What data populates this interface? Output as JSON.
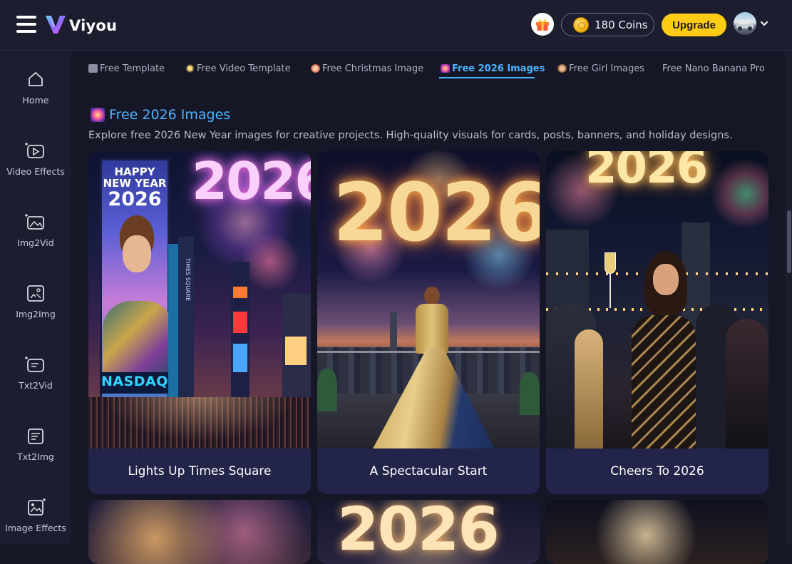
{
  "brand": {
    "name": "Viyou"
  },
  "header": {
    "coins_label": "180 Coins",
    "upgrade_label": "Upgrade",
    "accent_color": "#ffcb14"
  },
  "sidebar": {
    "items": [
      {
        "label": "Home",
        "icon": "home-icon"
      },
      {
        "label": "Video Effects",
        "icon": "video-effects-icon"
      },
      {
        "label": "Img2Vid",
        "icon": "img2vid-icon"
      },
      {
        "label": "Img2Img",
        "icon": "img2img-icon"
      },
      {
        "label": "Txt2Vid",
        "icon": "txt2vid-icon"
      },
      {
        "label": "Txt2Img",
        "icon": "txt2img-icon"
      },
      {
        "label": "Image Effects",
        "icon": "image-effects-icon"
      }
    ]
  },
  "tabs": [
    {
      "label": "Free Template",
      "icon": "template-icon",
      "active": false
    },
    {
      "label": "Free Video Template",
      "icon": "sparkle-icon",
      "active": false
    },
    {
      "label": "Free Christmas Image",
      "icon": "christmas-icon",
      "active": false
    },
    {
      "label": "Free 2026 Images",
      "icon": "fireworks-icon",
      "active": true
    },
    {
      "label": "Free Girl Images",
      "icon": "girl-icon",
      "active": false
    },
    {
      "label": "Free Nano Banana Pro",
      "icon": "",
      "active": false
    }
  ],
  "section": {
    "title": "Free 2026 Images",
    "description": "Explore free 2026 New Year images for creative projects. High-quality visuals for cards, posts, banners, and holiday designs.",
    "accent_color": "#4db3ff"
  },
  "cards": [
    {
      "caption": "Lights Up Times Square",
      "billboard_line1": "HAPPY",
      "billboard_line2": "NEW YEAR",
      "billboard_line3": "2026",
      "sky_text": "2026",
      "ticker": "NASDAQ",
      "vertical_sign": "TIMES SQUARE"
    },
    {
      "caption": "A Spectacular Start",
      "sky_text": "2026"
    },
    {
      "caption": "Cheers To 2026",
      "sky_text": "2026"
    }
  ],
  "next_row": [
    {
      "sky_text": ""
    },
    {
      "sky_text": "2026"
    },
    {
      "sky_text": ""
    }
  ]
}
